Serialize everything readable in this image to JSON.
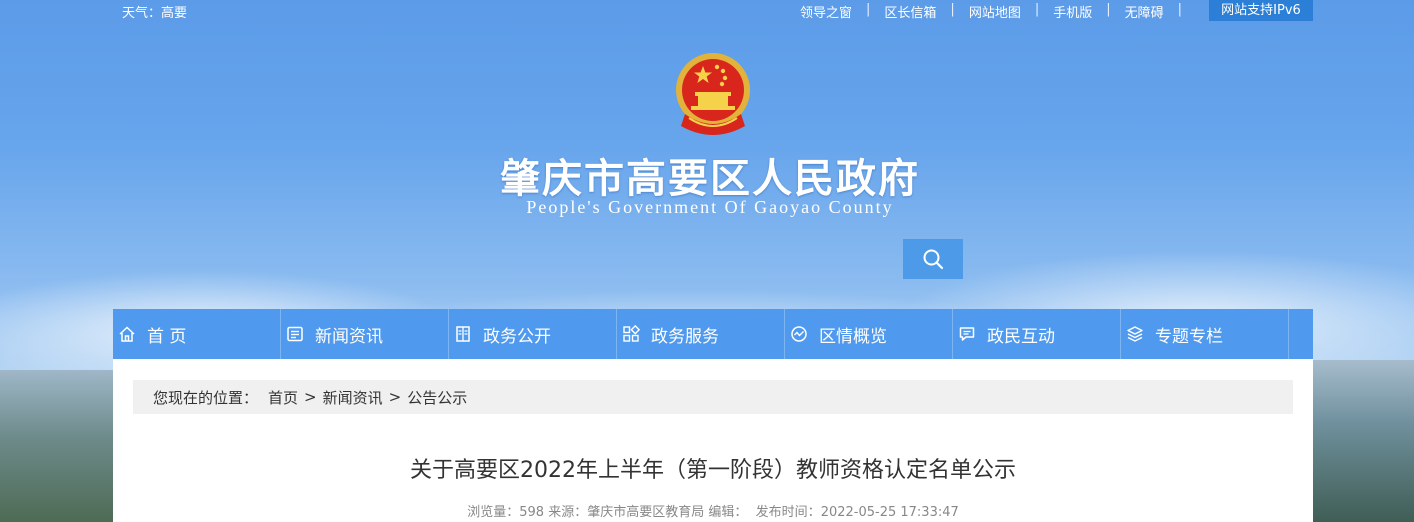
{
  "topbar": {
    "weather_label": "天气：",
    "weather_value": "高要",
    "links": [
      "领导之窗",
      "区长信箱",
      "网站地图",
      "手机版",
      "无障碍"
    ],
    "ipv6": "网站支持IPv6"
  },
  "header": {
    "title": "肇庆市高要区人民政府",
    "subtitle": "People's Government Of Gaoyao County"
  },
  "nav": {
    "items": [
      {
        "label": "首 页",
        "icon": "home-icon"
      },
      {
        "label": "新闻资讯",
        "icon": "news-icon"
      },
      {
        "label": "政务公开",
        "icon": "document-icon"
      },
      {
        "label": "政务服务",
        "icon": "grid-icon"
      },
      {
        "label": "区情概览",
        "icon": "chart-icon"
      },
      {
        "label": "政民互动",
        "icon": "chat-icon"
      },
      {
        "label": "专题专栏",
        "icon": "layers-icon"
      }
    ]
  },
  "breadcrumb": {
    "prefix": "您现在的位置：",
    "items": [
      "首页",
      "新闻资讯",
      "公告公示"
    ],
    "separator": ">"
  },
  "article": {
    "title": "关于高要区2022年上半年（第一阶段）教师资格认定名单公示",
    "views_label": "浏览量：",
    "views": "598",
    "source_label": "来源：",
    "source": "肇庆市高要区教育局",
    "editor_label": "编辑：",
    "time_label": "发布时间：",
    "time": "2022-05-25 17:33:47"
  },
  "colors": {
    "nav_bg": "#4f9aee",
    "ipv6_bg": "#2b7fd6",
    "search_bg": "#4d9ae8"
  }
}
